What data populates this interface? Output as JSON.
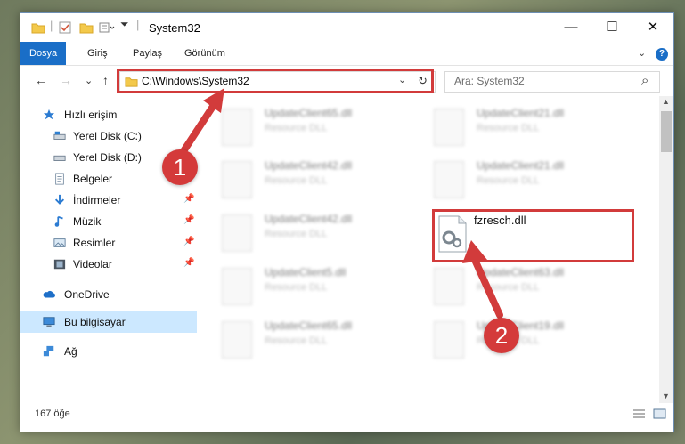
{
  "window": {
    "title": "System32",
    "minimize": "—",
    "maximize": "☐",
    "close": "✕"
  },
  "ribbon": {
    "tabs": [
      "Dosya",
      "Giriş",
      "Paylaş",
      "Görünüm"
    ],
    "help": "?",
    "chevron": "⌄"
  },
  "nav": {
    "back": "←",
    "forward": "→",
    "recent": "⌄",
    "up": "↑",
    "dropdown": "⌄",
    "refresh": "↻"
  },
  "address": {
    "path": "C:\\Windows\\System32"
  },
  "search": {
    "placeholder": "Ara: System32",
    "icon": "⌕"
  },
  "sidebar": {
    "items": [
      {
        "label": "Hızlı erişim",
        "icon": "star-icon"
      },
      {
        "label": "Yerel Disk (C:)",
        "icon": "drive-icon"
      },
      {
        "label": "Yerel Disk (D:)",
        "icon": "drive-icon"
      },
      {
        "label": "Belgeler",
        "icon": "documents-icon"
      },
      {
        "label": "İndirmeler",
        "icon": "download-icon"
      },
      {
        "label": "Müzik",
        "icon": "music-icon"
      },
      {
        "label": "Resimler",
        "icon": "pictures-icon"
      },
      {
        "label": "Videolar",
        "icon": "video-icon"
      },
      {
        "label": "OneDrive",
        "icon": "cloud-icon"
      },
      {
        "label": "Bu bilgisayar",
        "icon": "computer-icon"
      },
      {
        "label": "Ağ",
        "icon": "network-icon"
      }
    ],
    "pin": "📌"
  },
  "files": {
    "left": [
      {
        "name": "UpdateClient65.dll",
        "type": "Resource DLL"
      },
      {
        "name": "UpdateClient42.dll",
        "type": "Resource DLL"
      },
      {
        "name": "UpdateClient42.dll",
        "type": "Resource DLL"
      },
      {
        "name": "UpdateClient5.dll",
        "type": "Resource DLL"
      },
      {
        "name": "UpdateClient65.dll",
        "type": "Resource DLL"
      }
    ],
    "right": [
      {
        "name": "UpdateClient21.dll",
        "type": "Resource DLL"
      },
      {
        "name": "UpdateClient21.dll",
        "type": "Resource DLL"
      },
      {
        "name": "fzresch.dll",
        "type": ""
      },
      {
        "name": "UpdateClient63.dll",
        "type": "Resource DLL"
      },
      {
        "name": "UpdateClient19.dll",
        "type": "Resource DLL"
      }
    ]
  },
  "status": {
    "count": "167 öğe"
  },
  "callouts": {
    "one": "1",
    "two": "2"
  },
  "colors": {
    "accent": "#1a6ec7",
    "highlight": "#d23b3b",
    "selection": "#cce8ff"
  }
}
